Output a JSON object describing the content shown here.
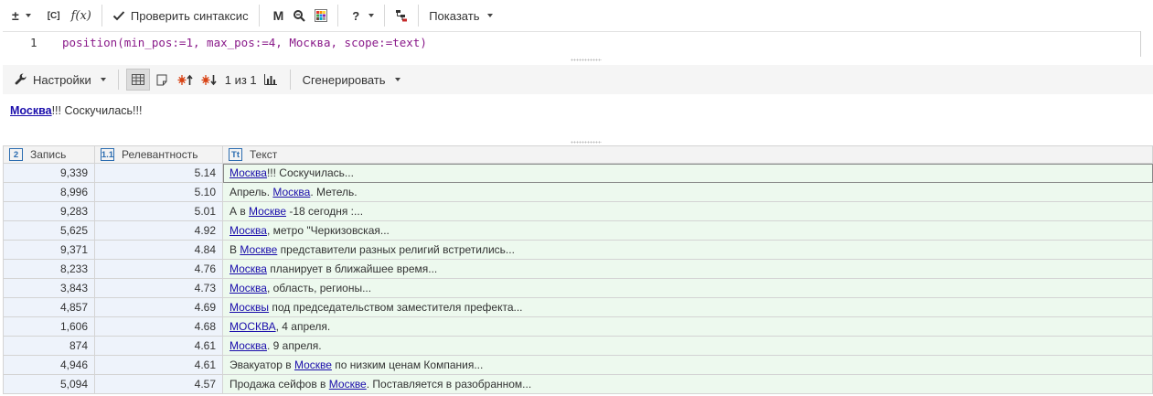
{
  "toolbar": {
    "plusminus": "±",
    "c_label": "[C]",
    "fx_label": "f(x)",
    "check_syntax": "Проверить синтаксис",
    "m_label": "M",
    "help_label": "?",
    "show_label": "Показать"
  },
  "editor": {
    "line_number": "1",
    "code": "position(min_pos:=1, max_pos:=4, Москва, scope:=text)"
  },
  "results_toolbar": {
    "settings_label": "Настройки",
    "page_info": "1 из 1",
    "generate_label": "Сгенерировать"
  },
  "preview": {
    "highlight": "Москва",
    "rest": "!!! Соскучилась!!!"
  },
  "table": {
    "columns": [
      {
        "icon": "2",
        "label": "Запись"
      },
      {
        "icon": "1.1",
        "label": "Релевантность"
      },
      {
        "icon": "Tt",
        "label": "Текст"
      }
    ],
    "rows": [
      {
        "record": "9,339",
        "relevance": "5.14",
        "pre": "",
        "match": "Москва",
        "post": "!!! Соскучилась..."
      },
      {
        "record": "8,996",
        "relevance": "5.10",
        "pre": "Апрель. ",
        "match": "Москва",
        "post": ". Метель."
      },
      {
        "record": "9,283",
        "relevance": "5.01",
        "pre": "А в ",
        "match": "Москве",
        "post": " -18 сегодня :..."
      },
      {
        "record": "5,625",
        "relevance": "4.92",
        "pre": "",
        "match": "Москва",
        "post": ", метро \"Черкизовская..."
      },
      {
        "record": "9,371",
        "relevance": "4.84",
        "pre": "В ",
        "match": "Москве",
        "post": " представители разных религий встретились..."
      },
      {
        "record": "8,233",
        "relevance": "4.76",
        "pre": "",
        "match": "Москва",
        "post": " планирует в ближайшее время..."
      },
      {
        "record": "3,843",
        "relevance": "4.73",
        "pre": "",
        "match": "Москва",
        "post": ", область, регионы..."
      },
      {
        "record": "4,857",
        "relevance": "4.69",
        "pre": "",
        "match": "Москвы",
        "post": " под председательством заместителя префекта..."
      },
      {
        "record": "1,606",
        "relevance": "4.68",
        "pre": "",
        "match": "МОСКВА",
        "post": ", 4 апреля."
      },
      {
        "record": "874",
        "relevance": "4.61",
        "pre": "",
        "match": "Москва",
        "post": ". 9 апреля."
      },
      {
        "record": "4,946",
        "relevance": "4.61",
        "pre": "Эвакуатор в ",
        "match": "Москве",
        "post": " по низким ценам Компания..."
      },
      {
        "record": "5,094",
        "relevance": "4.57",
        "pre": "Продажа сейфов в ",
        "match": "Москве",
        "post": ". Поставляется в разобранном..."
      }
    ]
  }
}
